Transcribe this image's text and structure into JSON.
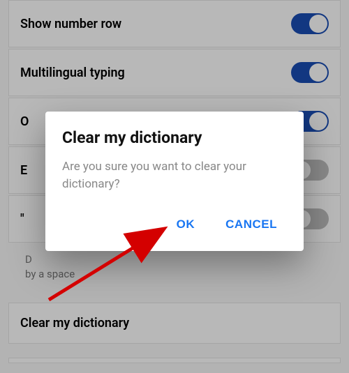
{
  "settings": {
    "items": [
      {
        "label": "Show number row",
        "toggle": true
      },
      {
        "label": "Multilingual typing",
        "toggle": true
      },
      {
        "label": "O",
        "toggle": true
      },
      {
        "label": "E",
        "toggle": false
      },
      {
        "label": "\"",
        "toggle": false
      }
    ],
    "description_line1": "D",
    "description_line2": "by a space",
    "clear_item_label": "Clear my dictionary"
  },
  "dialog": {
    "title": "Clear my dictionary",
    "message": "Are you sure you want to clear your dictionary?",
    "ok_label": "OK",
    "cancel_label": "CANCEL"
  },
  "colors": {
    "toggle_on": "#1a4db3",
    "dialog_action": "#1976f2",
    "arrow": "#d40000"
  }
}
